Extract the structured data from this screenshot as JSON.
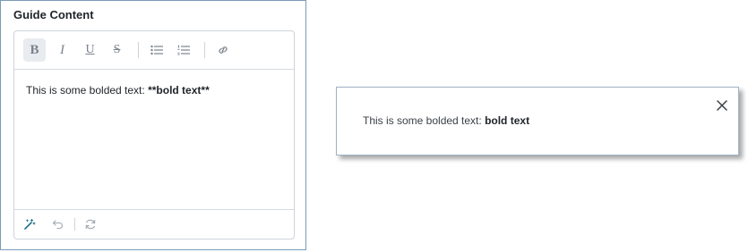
{
  "panel": {
    "title": "Guide Content"
  },
  "toolbar": {
    "bold_glyph": "B",
    "italic_glyph": "I",
    "underline_glyph": "U",
    "strike_glyph": "S",
    "active_button": "bold"
  },
  "editor": {
    "text_prefix": "This is some bolded text: ",
    "text_markdown": "**bold text**"
  },
  "preview": {
    "text_prefix": "This is some bolded text: ",
    "text_bold": "bold text"
  },
  "colors": {
    "panel_border": "#7a9bb6",
    "icon_gray": "#7a828c",
    "magic_wand_teal": "#1d6f8a",
    "active_bg": "#e8ebef"
  },
  "icons": {
    "bullet_list": "bullet-list-icon",
    "numbered_list": "numbered-list-icon",
    "link": "link-icon",
    "magic_wand": "magic-wand-icon",
    "undo": "undo-icon",
    "redo": "redo-icon",
    "close": "close-icon"
  }
}
